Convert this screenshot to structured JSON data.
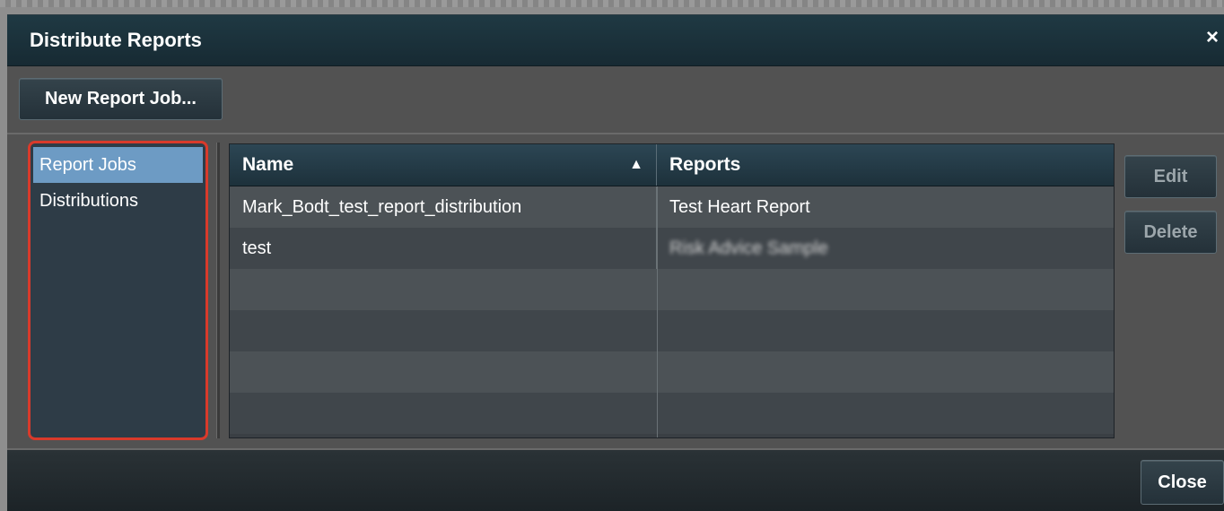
{
  "dialog": {
    "title": "Distribute Reports",
    "close_icon": "×"
  },
  "toolbar": {
    "new_report_job_label": "New Report Job..."
  },
  "left_list": {
    "items": [
      {
        "label": "Report Jobs",
        "selected": true
      },
      {
        "label": "Distributions",
        "selected": false
      }
    ]
  },
  "table": {
    "columns": [
      {
        "label": "Name",
        "sort": "ascending",
        "sort_icon": "▲"
      },
      {
        "label": "Reports"
      }
    ],
    "rows": [
      {
        "name": "Mark_Bodt_test_report_distribution",
        "reports": "Test Heart Report"
      },
      {
        "name": "test",
        "reports": "Risk Advice Sample"
      }
    ]
  },
  "side_buttons": {
    "edit_label": "Edit",
    "delete_label": "Delete"
  },
  "footer": {
    "close_label": "Close"
  },
  "colors": {
    "selected_item": "#6d9bc4",
    "highlight_border": "#d93a2b",
    "titlebar": "#1f3943"
  }
}
